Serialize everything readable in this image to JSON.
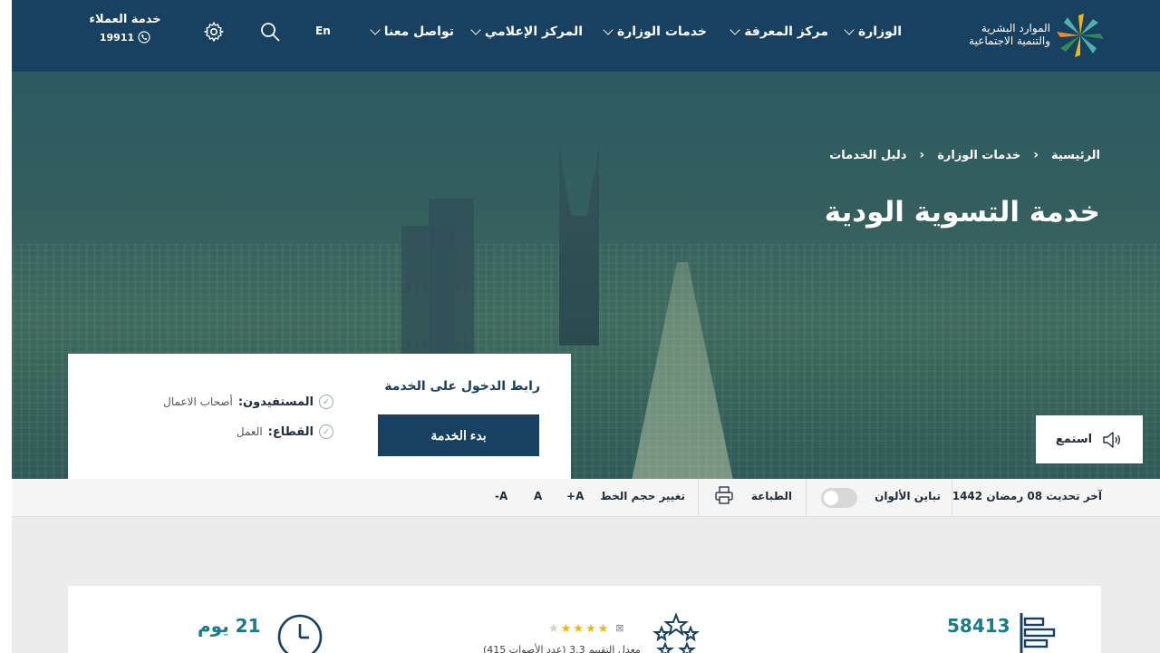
{
  "header": {
    "logo_line1": "الموارد البشرية",
    "logo_line2": "والتنمية الاجتماعية",
    "nav": [
      "الوزارة",
      "مركز المعرفة",
      "خدمات الوزارة",
      "المركز الإعلامي",
      "تواصل معنا"
    ],
    "lang": "En",
    "customer_service": "خدمة العملاء",
    "customer_number": "19911"
  },
  "hero": {
    "breadcrumb": [
      "الرئيسية",
      "خدمات الوزارة",
      "دليل الخدمات"
    ],
    "title": "خدمة التسوية الودية",
    "listen": "استمع"
  },
  "card": {
    "heading": "رابط الدخول على الخدمة",
    "button": "بدء الخدمة",
    "beneficiaries_label": "المستفيدون:",
    "beneficiaries_value": "أصحاب الاعمال",
    "sector_label": "القطاع:",
    "sector_value": "العمل"
  },
  "toolbar": {
    "last_update": "آخر تحديث 08 رمضان 1442",
    "contrast": "تباين الألوان",
    "print": "الطباعة",
    "font_size": "تغيير حجم الخط",
    "font_plus": "A+",
    "font_normal": "A",
    "font_minus": "A-"
  },
  "stats": {
    "visits": "58413",
    "rating_text": "معدل التقييم 3.3 (عدد الأصوات 415)",
    "duration": "21 يوم",
    "rating_value": 4,
    "rating_max": 5
  },
  "colors": {
    "header_bg": "#174061",
    "accent": "#1b7a8a",
    "star": "#f2b705"
  }
}
